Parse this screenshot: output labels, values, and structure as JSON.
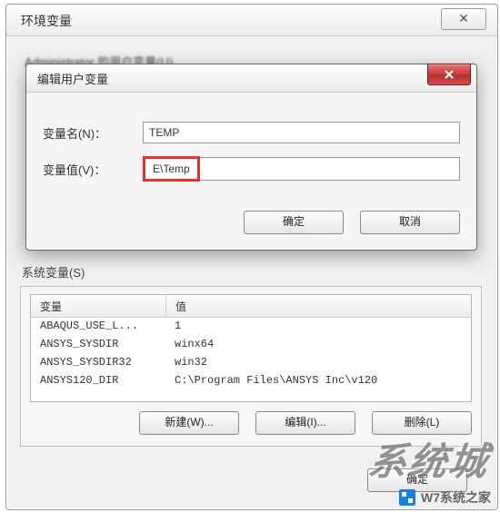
{
  "outer": {
    "title": "环境变量",
    "close_glyph": "✕",
    "user_vars_label": "Administrator 的用户变量(U)"
  },
  "dialog": {
    "title": "编辑用户变量",
    "name_label": "变量名(N)：",
    "value_label": "变量值(V)：",
    "name_value": "TEMP",
    "value_value": "E\\Temp",
    "ok": "确定",
    "cancel": "取消"
  },
  "sys": {
    "label": "系统变量(S)",
    "col_var": "变量",
    "col_val": "值",
    "rows": [
      {
        "var": "ABAQUS_USE_L...",
        "val": "1"
      },
      {
        "var": "ANSYS_SYSDIR",
        "val": "winx64"
      },
      {
        "var": "ANSYS_SYSDIR32",
        "val": "win32"
      },
      {
        "var": "ANSYS120_DIR",
        "val": "C:\\Program Files\\ANSYS Inc\\v120"
      }
    ],
    "new_btn": "新建(W)...",
    "edit_btn": "编辑(I)...",
    "del_btn": "删除(L)"
  },
  "main": {
    "ok": "确定"
  },
  "watermark": {
    "big": "系统城",
    "small": "W7系统之家"
  }
}
